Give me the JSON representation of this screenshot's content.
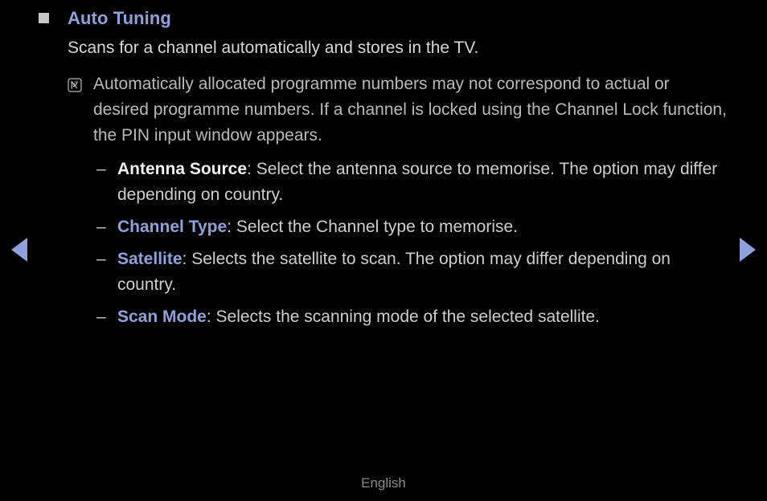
{
  "colors": {
    "background": "#000000",
    "accent_blue": "#8fa1dc",
    "body_text": "#d8d8d8",
    "note_text": "#b9b9b9",
    "bullet_square": "#c9c9c9",
    "footer_text": "#8a8a8a"
  },
  "nav": {
    "prev_icon": "triangle-left-icon",
    "next_icon": "triangle-right-icon"
  },
  "section": {
    "bullet_icon": "square-bullet-icon",
    "title": "Auto Tuning",
    "description": "Scans for a channel automatically and stores in the TV."
  },
  "note": {
    "icon": "note-pen-icon",
    "text": "Automatically allocated programme numbers may not correspond to actual or desired programme numbers. If a channel is locked using the Channel Lock function, the PIN input window appears."
  },
  "options": [
    {
      "dash": "–",
      "term": "Antenna Source",
      "term_style": "white",
      "separator": ": ",
      "description": "Select the antenna source to memorise. The option may differ depending on country."
    },
    {
      "dash": "–",
      "term": "Channel Type",
      "term_style": "blue",
      "separator": ": ",
      "description": "Select the Channel type to memorise."
    },
    {
      "dash": "–",
      "term": "Satellite",
      "term_style": "blue",
      "separator": ": ",
      "description": "Selects the satellite to scan. The option may differ depending on country."
    },
    {
      "dash": "–",
      "term": "Scan Mode",
      "term_style": "blue",
      "separator": ": ",
      "description": "Selects the scanning mode of the selected satellite."
    }
  ],
  "footer": {
    "language": "English"
  }
}
